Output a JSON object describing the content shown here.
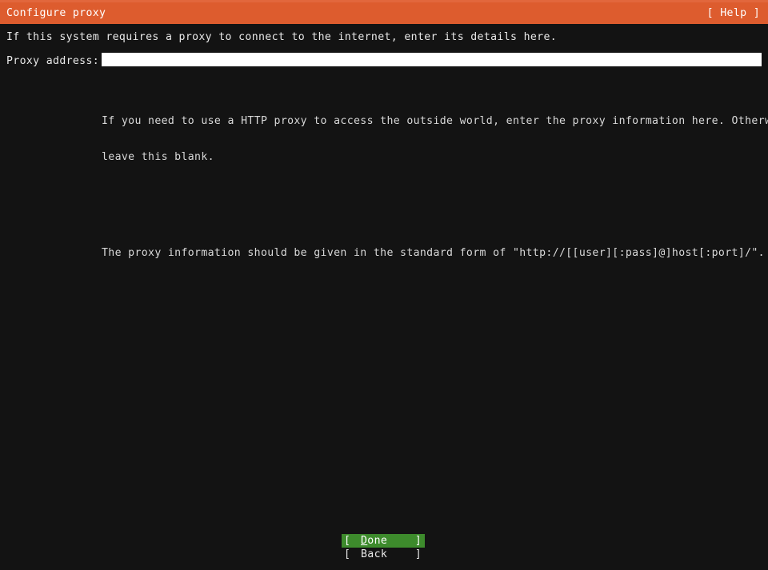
{
  "window": {
    "title": "Configure proxy",
    "help_label": "[ Help ]",
    "accent_orange": "#dd5c2e",
    "accent_green": "#3d8b2c",
    "background": "#131313",
    "foreground": "#e8e8e8"
  },
  "main": {
    "intro": "If this system requires a proxy to connect to the internet, enter its details here.",
    "field": {
      "label": "Proxy address:",
      "value": "",
      "placeholder": ""
    },
    "help_paragraphs": [
      [
        "If you need to use a HTTP proxy to access the outside world, enter the proxy information here. Otherwise,",
        "leave this blank."
      ],
      [
        "The proxy information should be given in the standard form of \"http://[[user][:pass]@]host[:port]/\"."
      ]
    ]
  },
  "footer": {
    "buttons": [
      {
        "bracket_left": "[",
        "accel": "D",
        "rest": "one",
        "bracket_right": "]",
        "selected": true
      },
      {
        "bracket_left": "[",
        "accel": "B",
        "rest": "ack",
        "bracket_right": "]",
        "selected": false
      }
    ]
  }
}
